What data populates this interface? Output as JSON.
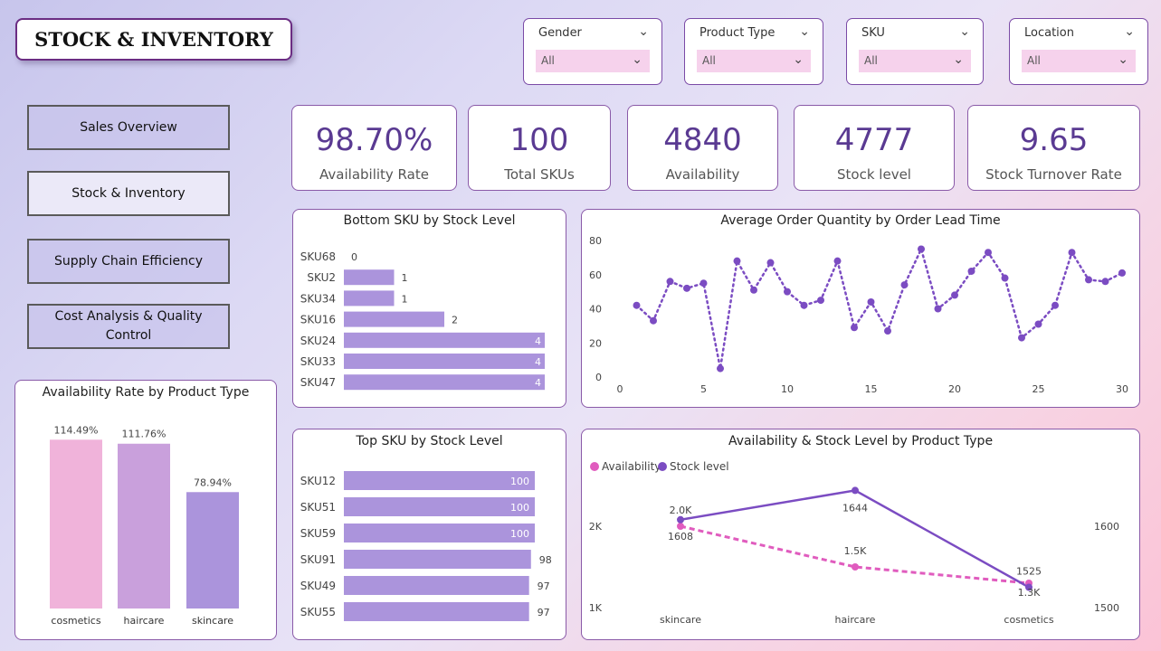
{
  "header": {
    "title": "STOCK & INVENTORY"
  },
  "filters": [
    {
      "label": "Gender",
      "value": "All"
    },
    {
      "label": "Product Type",
      "value": "All"
    },
    {
      "label": "SKU",
      "value": "All"
    },
    {
      "label": "Location",
      "value": "All"
    }
  ],
  "nav": [
    {
      "label": "Sales Overview"
    },
    {
      "label": "Stock & Inventory"
    },
    {
      "label": "Supply Chain Efficiency"
    },
    {
      "label": "Cost Analysis & Quality Control"
    }
  ],
  "kpis": [
    {
      "value": "98.70%",
      "caption": "Availability Rate"
    },
    {
      "value": "100",
      "caption": "Total SKUs"
    },
    {
      "value": "4840",
      "caption": "Availability"
    },
    {
      "value": "4777",
      "caption": "Stock level"
    },
    {
      "value": "9.65",
      "caption": "Stock Turnover Rate"
    }
  ],
  "colors": {
    "purple": "#7b4cc2",
    "pink": "#e05cbe",
    "bar": "#ab94dc",
    "bar_pink": "#f0b3da",
    "bar_mid": "#c9a0dc",
    "bar_dark": "#ab94dc"
  },
  "chart_data": [
    {
      "type": "bar",
      "title": "Availability Rate by Product Type",
      "categories": [
        "cosmetics",
        "haircare",
        "skincare"
      ],
      "values": [
        114.49,
        111.76,
        78.94
      ],
      "labels": [
        "114.49%",
        "111.76%",
        "78.94%"
      ],
      "ylim": [
        0,
        130
      ]
    },
    {
      "type": "bar",
      "orientation": "horizontal",
      "title": "Bottom SKU by Stock Level",
      "categories": [
        "SKU68",
        "SKU2",
        "SKU34",
        "SKU16",
        "SKU24",
        "SKU33",
        "SKU47"
      ],
      "values": [
        0,
        1,
        1,
        2,
        4,
        4,
        4
      ],
      "xlim": [
        0,
        4
      ]
    },
    {
      "type": "line",
      "title": "Average Order Quantity by Order Lead Time",
      "x": [
        1,
        2,
        3,
        4,
        5,
        6,
        7,
        8,
        9,
        10,
        11,
        12,
        13,
        14,
        15,
        16,
        17,
        18,
        19,
        20,
        21,
        22,
        23,
        24,
        25,
        26,
        27,
        28,
        29,
        30
      ],
      "y": [
        42,
        33,
        56,
        52,
        55,
        5,
        68,
        51,
        67,
        50,
        42,
        45,
        68,
        29,
        44,
        27,
        54,
        75,
        40,
        48,
        62,
        73,
        58,
        23,
        31,
        42,
        73,
        57,
        56,
        61
      ],
      "xticks": [
        "0",
        "5",
        "10",
        "15",
        "20",
        "25",
        "30"
      ],
      "yticks": [
        "0",
        "20",
        "40",
        "60",
        "80"
      ],
      "xlim": [
        0,
        30
      ],
      "ylim": [
        0,
        80
      ]
    },
    {
      "type": "bar",
      "orientation": "horizontal",
      "title": "Top SKU by Stock Level",
      "categories": [
        "SKU12",
        "SKU51",
        "SKU59",
        "SKU91",
        "SKU49",
        "SKU55"
      ],
      "values": [
        100,
        100,
        100,
        98,
        97,
        97
      ],
      "xlim": [
        0,
        100
      ]
    },
    {
      "type": "line",
      "title": "Availability & Stock Level by Product Type",
      "categories": [
        "skincare",
        "haircare",
        "cosmetics"
      ],
      "legend_position": "top-left",
      "series": [
        {
          "name": "Availability",
          "values": [
            2000,
            1500,
            1300
          ],
          "labels": [
            "2.0K",
            "1.5K",
            "1.3K"
          ],
          "axis": "left",
          "style": "dotted"
        },
        {
          "name": "Stock level",
          "values": [
            1608,
            1644,
            1525
          ],
          "labels": [
            "1608",
            "1644",
            "1525"
          ],
          "axis": "right",
          "style": "solid"
        }
      ],
      "left_ticks": [
        "2K",
        "1K"
      ],
      "right_ticks": [
        "1600",
        "1500"
      ]
    }
  ]
}
